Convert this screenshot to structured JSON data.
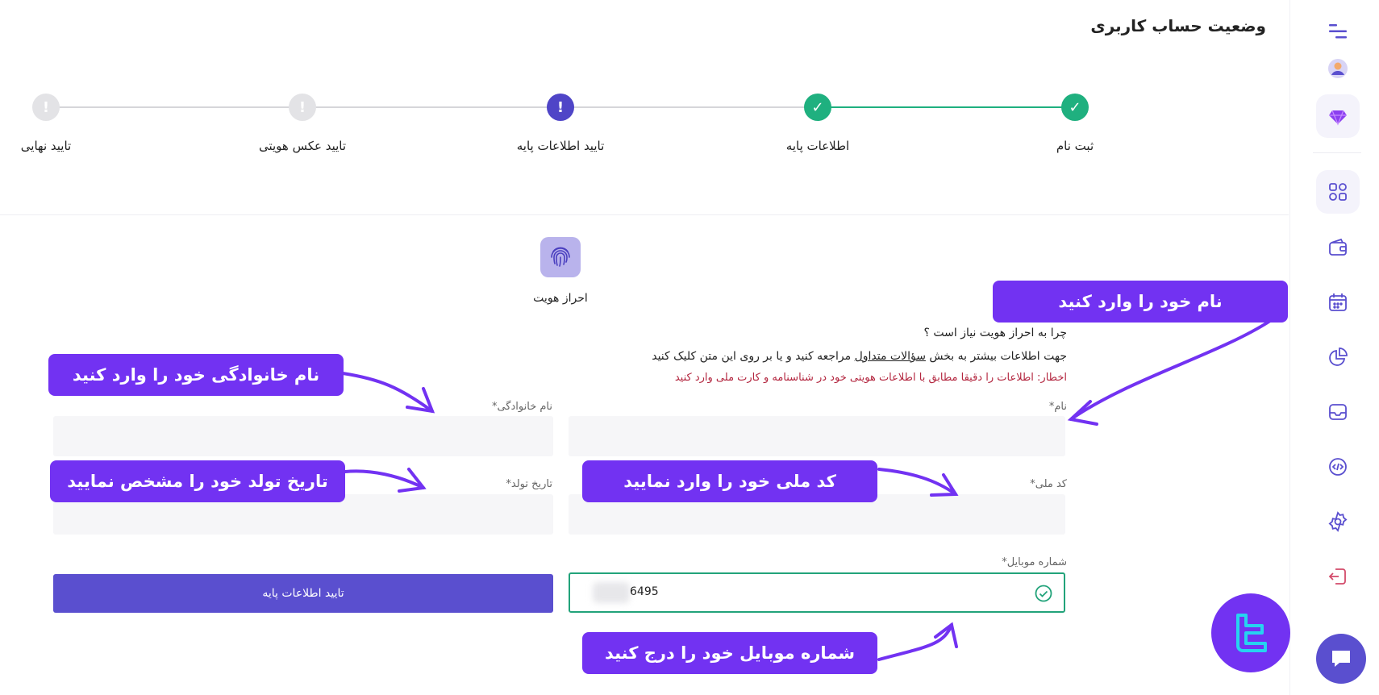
{
  "header": {
    "title": "وضعیت حساب کاربری"
  },
  "stepper": {
    "steps": [
      {
        "label": "ثبت نام",
        "state": "done"
      },
      {
        "label": "اطلاعات پایه",
        "state": "done"
      },
      {
        "label": "تایید اطلاعات پایه",
        "state": "current"
      },
      {
        "label": "تایید عکس هویتی",
        "state": "pending"
      },
      {
        "label": "تایید نهایی",
        "state": "pending"
      }
    ]
  },
  "identity": {
    "label": "احراز هویت",
    "question": "چرا به احراز هویت نیاز است ؟",
    "help_prefix": "جهت اطلاعات بیشتر به بخش ",
    "help_link": "سؤالات متداول",
    "help_suffix": " مراجعه کنید و یا بر روی این متن کلیک کنید",
    "warning": "اخطار: اطلاعات را دقیقا مطابق با اطلاعات هویتی خود در شناسنامه و کارت ملی وارد کنید"
  },
  "form": {
    "first_name_label": "نام*",
    "last_name_label": "نام خانوادگی*",
    "national_code_label": "کد ملی*",
    "birth_date_label": "تاریخ تولد*",
    "mobile_label": "شماره موبایل*",
    "mobile_value": "6495",
    "submit_label": "تایید اطلاعات پایه"
  },
  "callouts": {
    "first_name": "نام خود را وارد کنید",
    "last_name": "نام خانوادگی خود را وارد کنید",
    "birth_date": "تاریخ تولد خود را مشخص نمایید",
    "national_code": "کد ملی خود را وارد نمایید",
    "mobile": "شماره موبایل خود را درج کنید"
  },
  "sidebar": {
    "items": [
      "menu-icon",
      "avatar",
      "diamond-icon",
      "dashboard-icon",
      "wallet-icon",
      "calendar-icon",
      "chart-icon",
      "inbox-icon",
      "code-icon",
      "settings-icon",
      "logout-icon"
    ]
  },
  "colors": {
    "accent": "#5a4fcf",
    "success": "#1fb07f",
    "callout": "#7232f2",
    "warning": "#b3263f"
  }
}
